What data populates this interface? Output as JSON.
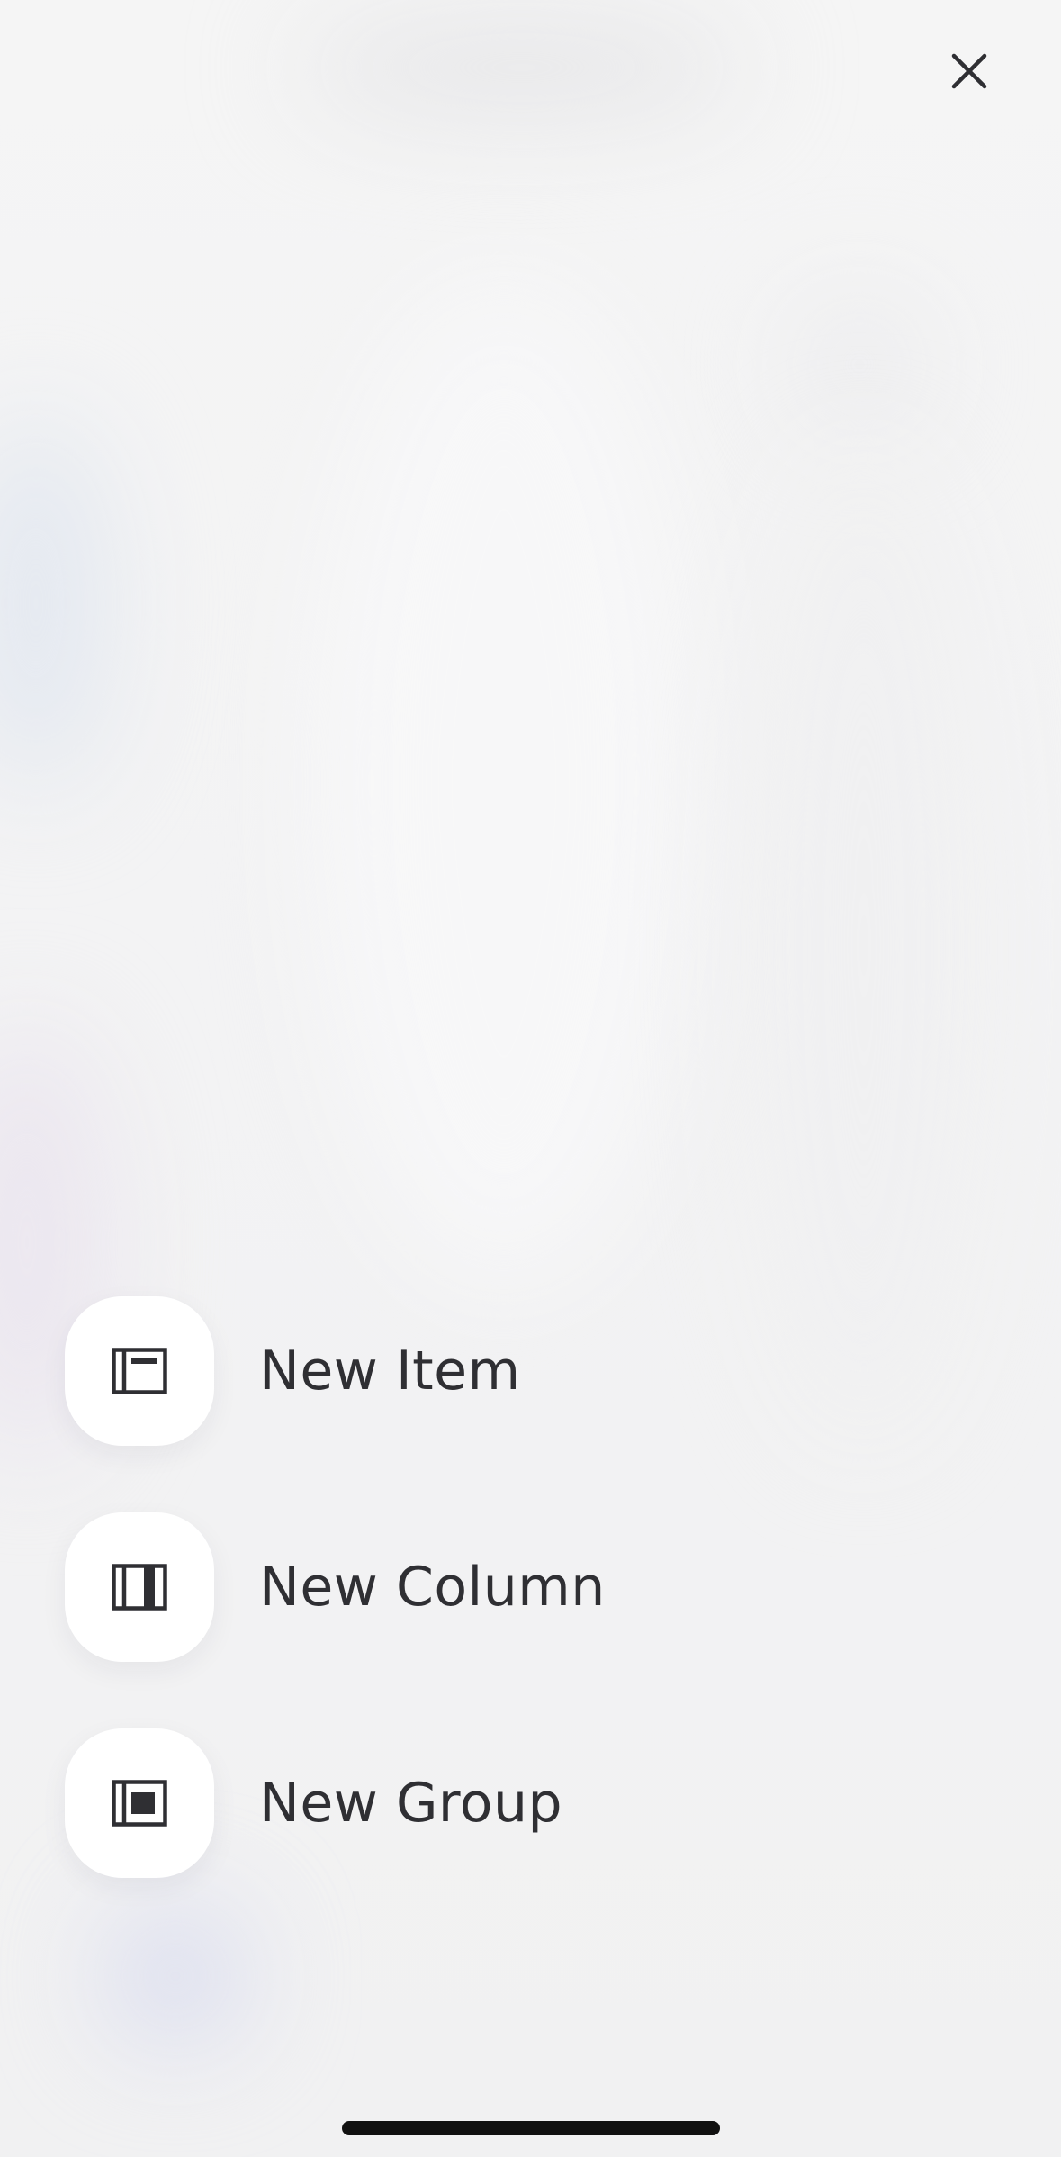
{
  "close_button": {
    "icon": "close-icon",
    "color": "#2f2f33"
  },
  "menu": {
    "items": [
      {
        "label": "New Item",
        "icon": "new-item-icon"
      },
      {
        "label": "New Column",
        "icon": "new-column-icon"
      },
      {
        "label": "New Group",
        "icon": "new-group-icon"
      }
    ]
  },
  "colors": {
    "background": "#f3f3f4",
    "tile": "#ffffff",
    "text": "#2f2f33",
    "home_indicator": "#111111"
  }
}
